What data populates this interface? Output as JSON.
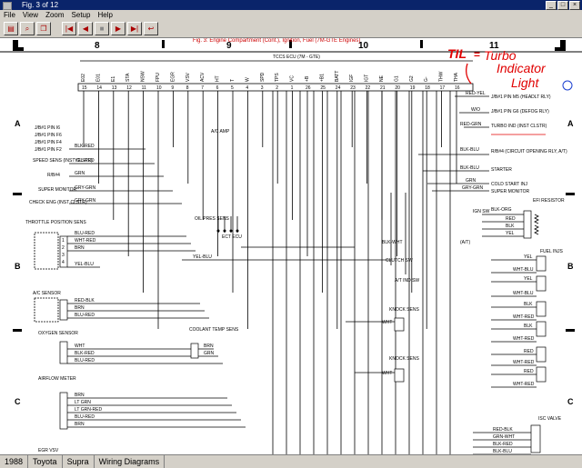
{
  "window": {
    "title": "Fig. 3 of 12"
  },
  "menu": [
    "File",
    "View",
    "Zoom",
    "Setup",
    "Help"
  ],
  "diagram": {
    "fig_title": "Fig. 3:  Engine Compartment (Cont.), Ignition, Fuel (7M-GTE Engines)",
    "ecu_title": "TCCS ECU (7M - GTE)",
    "columns": [
      "8",
      "9",
      "10",
      "11"
    ],
    "rows": [
      "A",
      "B",
      "C"
    ],
    "pin_numbers": [
      "15",
      "14",
      "13",
      "12",
      "11",
      "10",
      "9",
      "8",
      "7",
      "6",
      "5",
      "4",
      "3",
      "2",
      "1",
      "26",
      "25",
      "24",
      "23",
      "22",
      "21",
      "20",
      "19",
      "18",
      "17",
      "16"
    ],
    "pin_names": [
      "E02",
      "E01",
      "E1",
      "STA",
      "NSW",
      "FPU",
      "EGR",
      "VSV",
      "ACV",
      "HT",
      "T",
      "W",
      "SPD",
      "TPS",
      "VC",
      "+B",
      "+B1",
      "BATT",
      "IGF",
      "IGT",
      "NE",
      "G1",
      "G2",
      "G-",
      "THW",
      "THA"
    ],
    "left_labels": {
      "pins_top": [
        "J/B#1 PIN I6",
        "J/B#1 PIN F6",
        "J/B#1 PIN F4",
        "J/B#1 PIN F2"
      ],
      "speed": "SPEED SENS (INST CLSTR)",
      "rb": "R/B#4",
      "super": "SUPER MONITOR",
      "check": "CHECK ENG (INST CLSTR)",
      "throttle": "THROTTLE POSITION SENS",
      "ac": "A/C SENSOR",
      "oxygen": "OXYGEN SENSOR",
      "airflow": "AIRFLOW METER",
      "egr": "EGR VSV"
    },
    "center_labels": {
      "oil": "OIL PRES SENS",
      "ect": "ECT ECU",
      "ac_amp": "A/C AMP",
      "coolant": "COOLANT TEMP SENS",
      "clutch": "CLUTCH SW",
      "at_ind": "A/T IND SW",
      "knock1": "KNOCK SENS",
      "knock2": "KNOCK SENS",
      "at": "(A/T)"
    },
    "right_labels": {
      "r1": "J/B#1 PIN M5 (HEADLT RLY)",
      "r2": "J/B#1 PIN G6 (DEFOG RLY)",
      "r3": "TURBO IND (INST CLSTR)",
      "r4": "R/B#4 (CIRCUIT OPENING RLY, A/T)",
      "r5": "STARTER",
      "r6": "COLD START INJ",
      "r7": "SUPER MONITOR",
      "efi": "EFI RESISTOR",
      "ign": "IGN SW",
      "fuel": "FUEL INJS",
      "isc": "ISC VALVE"
    },
    "wire_colors": {
      "bb": "BLK-BLU",
      "yr": "YEL-RED",
      "grn": "GRN",
      "gg": "GRY-GRN",
      "br": "BLK-RED",
      "bur": "BLU-RED",
      "wr": "WHT-RED",
      "brn": "BRN",
      "yb": "YEL-BLU",
      "rbk": "RED-BLK",
      "blk": "BLK",
      "wht": "WHT",
      "lg": "LT GRN",
      "lgr": "LT GRN-RED",
      "ryel": "RED-YEL",
      "wo": "W/O",
      "rg": "RED-GRN",
      "bo": "BLK-ORG",
      "red": "RED",
      "yel": "YEL",
      "wb": "WHT-BLU",
      "gw": "GRN-WHT",
      "bw": "BLK-WHT"
    },
    "annotation": {
      "til": "TIL",
      "eq": "=",
      "line1": "Turbo",
      "line2": "Indicator",
      "line3": "Light",
      "color": "#e00000"
    }
  },
  "statusbar": {
    "items": [
      "1988",
      "Toyota",
      "Supra",
      "Wiring Diagrams"
    ]
  }
}
